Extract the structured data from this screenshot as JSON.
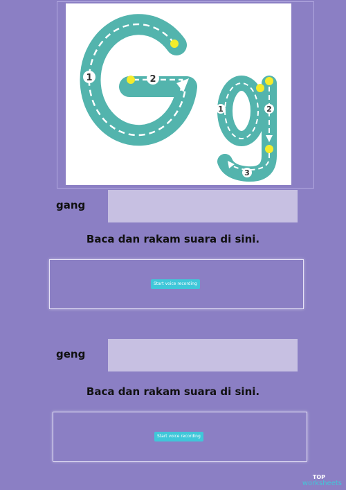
{
  "image": {
    "colors": {
      "stroke": "#53b4ad",
      "dots": "#f4ec2c",
      "background": "#ffffff"
    },
    "letter_big": "G",
    "letter_small": "g",
    "step_markers": [
      "1",
      "2",
      "1",
      "2",
      "3"
    ]
  },
  "items": [
    {
      "word": "gang",
      "instruction": "Baca dan rakam suara di sini.",
      "button_label": "Start voice recording"
    },
    {
      "word": "geng",
      "instruction": "Baca dan rakam suara di sini.",
      "button_label": "Start voice recording"
    }
  ],
  "brand": {
    "line1": "TOP",
    "line2": "worksheets"
  }
}
